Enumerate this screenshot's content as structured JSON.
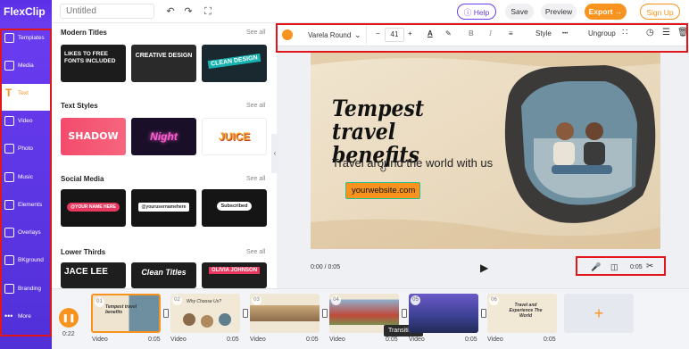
{
  "app": {
    "logo_text": "FlexClip",
    "title_placeholder": "Untitled",
    "help_label": "Help",
    "save_label": "Save",
    "preview_label": "Preview",
    "export_label": "Export →",
    "signup_label": "Sign Up"
  },
  "sidebar": {
    "items": [
      {
        "label": "Templates",
        "icon": "templates-icon"
      },
      {
        "label": "Media",
        "icon": "folder-icon"
      },
      {
        "label": "Text",
        "icon": "text-icon"
      },
      {
        "label": "Video",
        "icon": "video-icon"
      },
      {
        "label": "Photo",
        "icon": "photo-icon"
      },
      {
        "label": "Music",
        "icon": "music-icon"
      },
      {
        "label": "Elements",
        "icon": "elements-icon"
      },
      {
        "label": "Overlays",
        "icon": "overlays-icon"
      },
      {
        "label": "BKground",
        "icon": "background-icon"
      },
      {
        "label": "Branding",
        "icon": "branding-icon"
      },
      {
        "label": "More",
        "icon": "more-icon"
      }
    ],
    "active_index": 2
  },
  "panel": {
    "see_all": "See all",
    "sections": [
      {
        "title": "Modern Titles",
        "thumbs": [
          "LIKES TO FREE FONTS INCLUDED",
          "CREATIVE DESIGN",
          "CLEAN DESIGN"
        ]
      },
      {
        "title": "Text Styles",
        "thumbs": [
          "SHADOW",
          "Night",
          "JUICE"
        ]
      },
      {
        "title": "Social Media",
        "thumbs": [
          "@YOUR NAME HERE",
          "@yourusernamehere",
          "Subscribed"
        ]
      },
      {
        "title": "Lower Thirds",
        "thumbs": [
          "JACE LEE",
          "Clean Titles",
          "OLIVIA JOHNSON"
        ]
      }
    ]
  },
  "toolbar": {
    "font_name": "Varela Round",
    "font_size": "41",
    "minus": "−",
    "plus": "+",
    "bold": "B",
    "italic": "I",
    "style_label": "Style",
    "more": "•••",
    "ungroup_label": "Ungroup",
    "color": "#f7931e"
  },
  "stage": {
    "heading_line1": "Tempest travel",
    "heading_line2": "benefits",
    "subheading": "Travel around the world with us",
    "website": "yourwebsite.com"
  },
  "player": {
    "time": "0:00 / 0:05",
    "duration": "0:05"
  },
  "timeline": {
    "total_time": "0:22",
    "clips": [
      {
        "num": "01",
        "type": "Video",
        "dur": "0:05",
        "title": "Tempest travel benefits"
      },
      {
        "num": "02",
        "type": "Video",
        "dur": "0:05",
        "title": "Why Choose Us?"
      },
      {
        "num": "03",
        "type": "Video",
        "dur": "0:05",
        "title": ""
      },
      {
        "num": "04",
        "type": "Video",
        "dur": "0:05",
        "title": ""
      },
      {
        "num": "05",
        "type": "Video",
        "dur": "0:05",
        "title": ""
      },
      {
        "num": "06",
        "type": "Video",
        "dur": "0:05",
        "title": "Travel and Experience The World"
      }
    ],
    "tooltip": "Transitions",
    "add_label": "+"
  }
}
